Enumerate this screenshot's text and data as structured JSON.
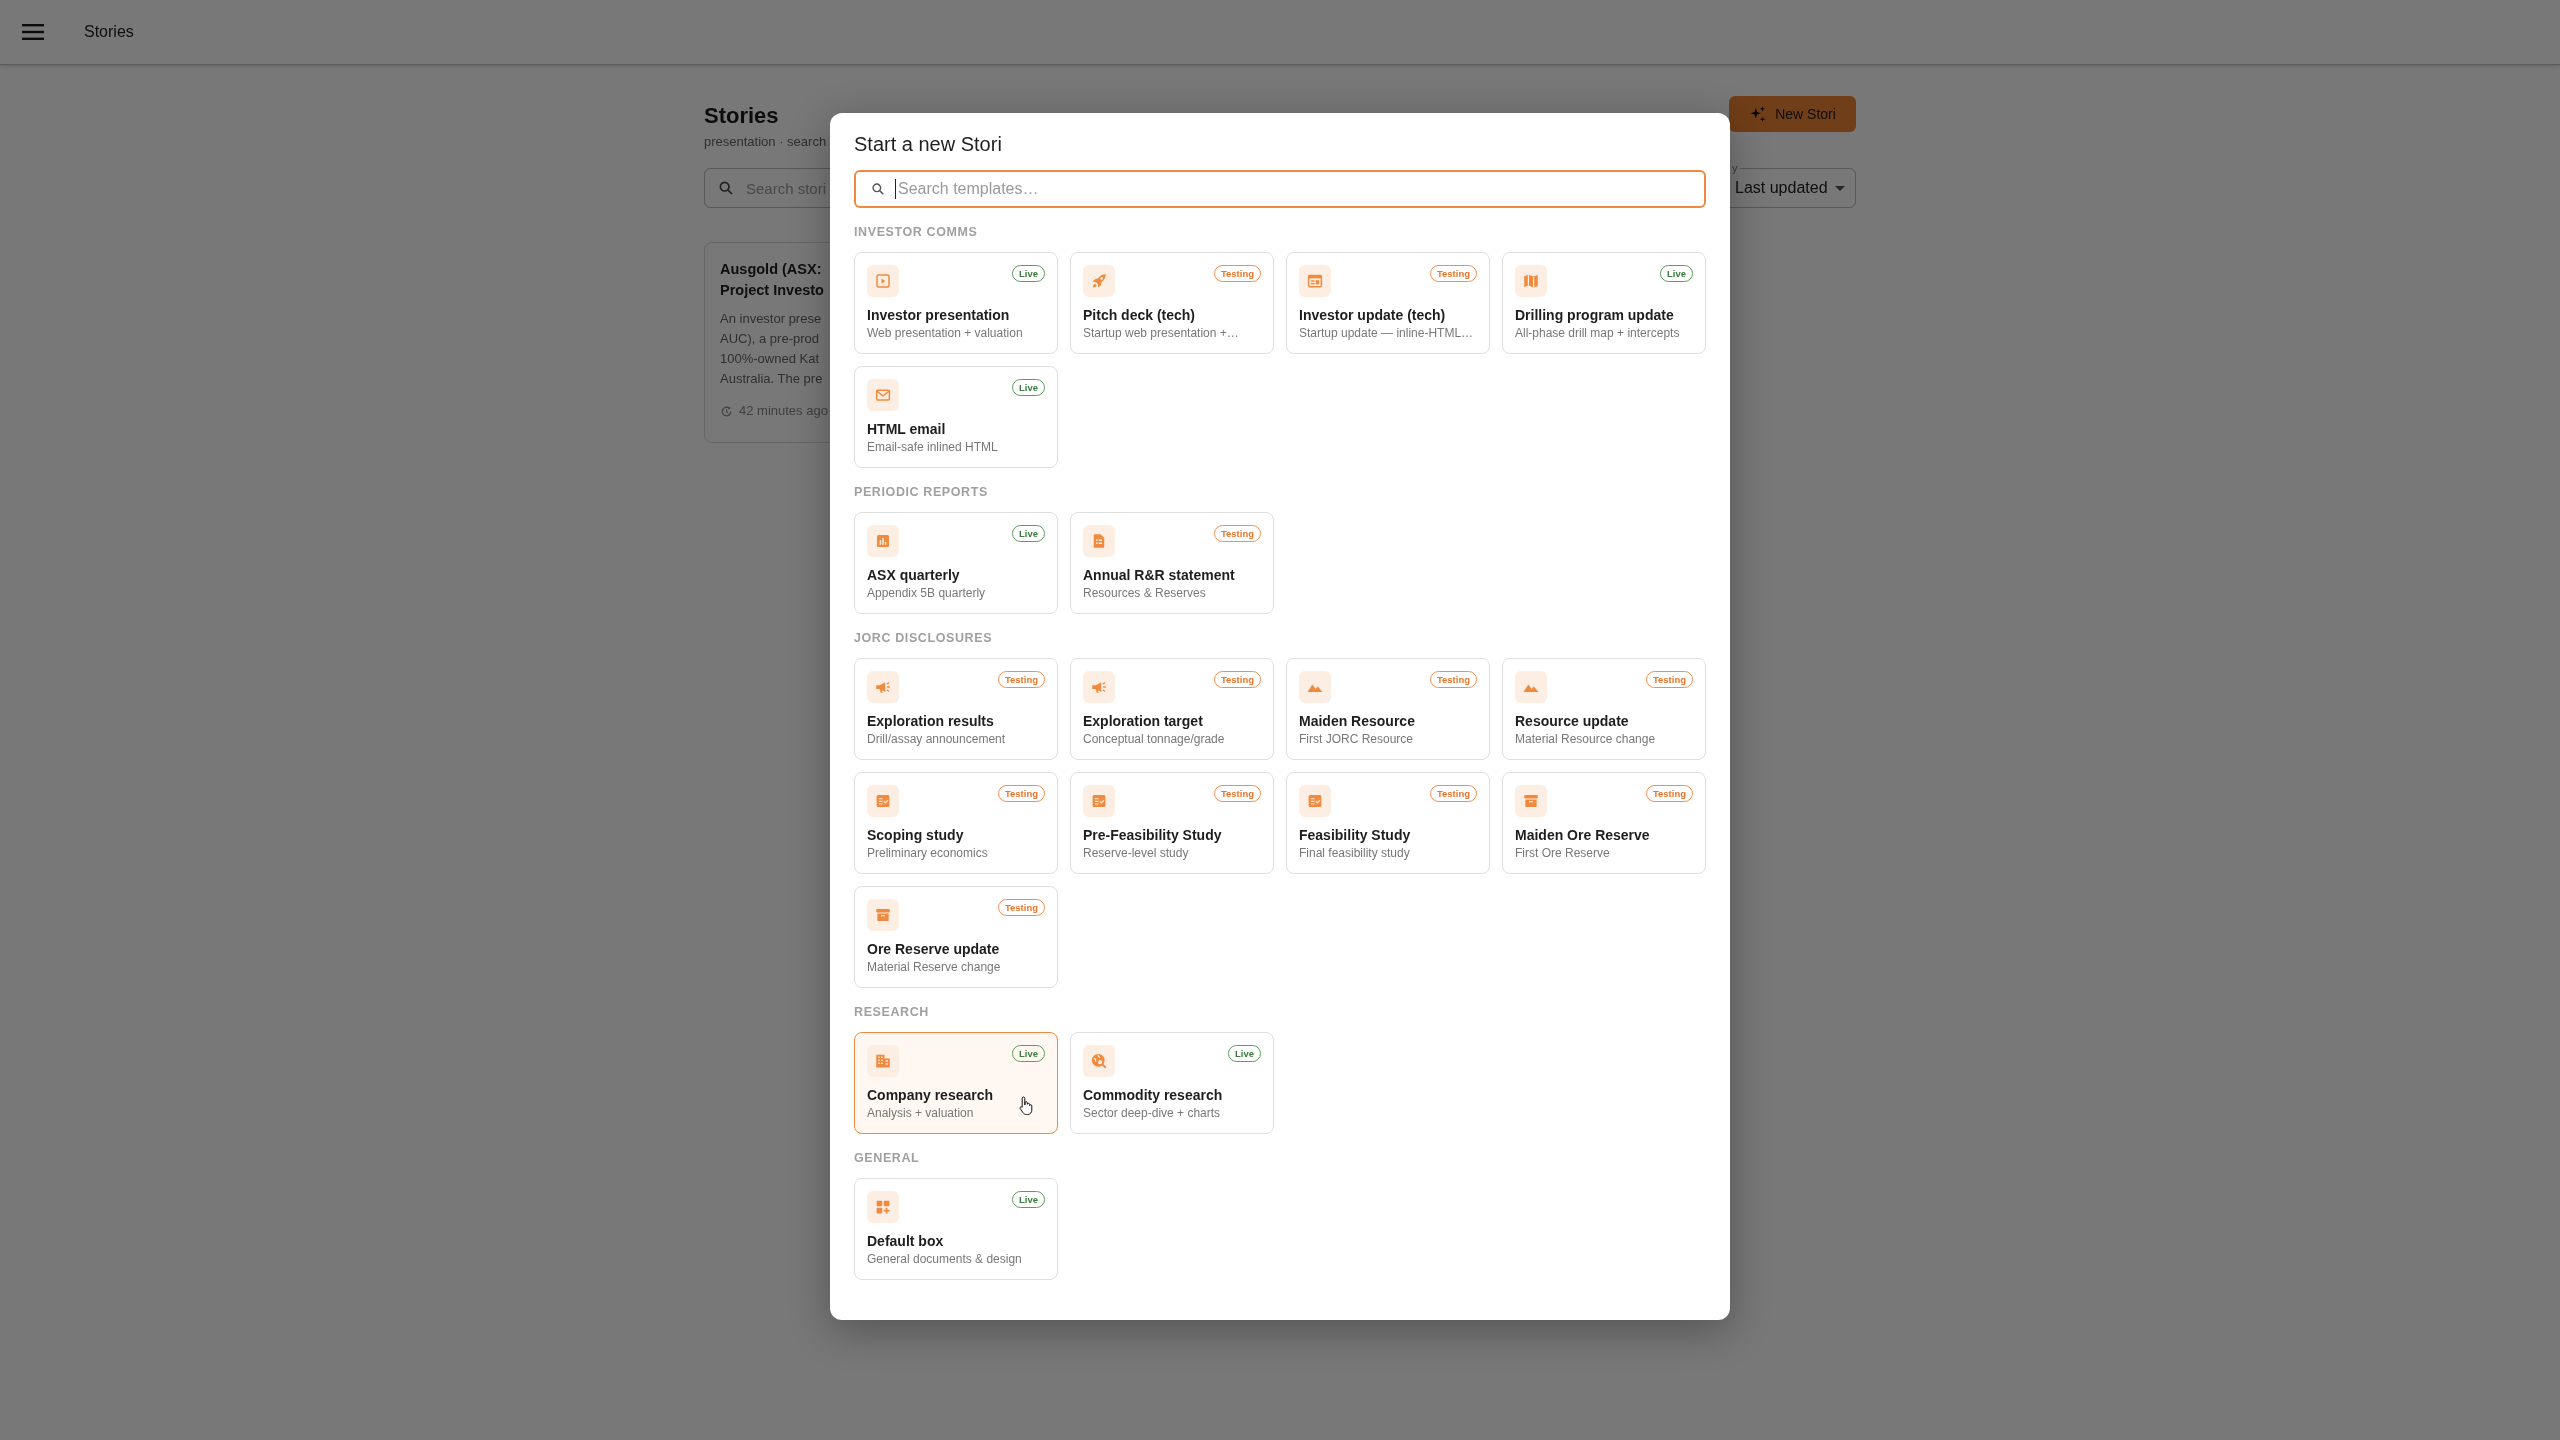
{
  "app_bar": {
    "title": "Stories"
  },
  "page": {
    "heading": "Stories",
    "subtitle": "presentation · search",
    "search": {
      "placeholder": "Search stori"
    },
    "new_button": "New Stori",
    "sort": {
      "label": "y",
      "value": "Last updated"
    },
    "stories": [
      {
        "title": "Ausgold (ASX:\nProject Investo",
        "description": "An investor prese\nAUC), a pre-prod\n100%-owned Kat\nAustralia. The pre",
        "updated": "42 minutes ago"
      }
    ]
  },
  "dialog": {
    "title": "Start a new Stori",
    "search": {
      "placeholder": "Search templates…",
      "focused": true
    },
    "sections": [
      {
        "title": "INVESTOR COMMS",
        "templates": [
          {
            "name": "Investor presentation",
            "description": "Web presentation + valuation",
            "badge": {
              "kind": "live",
              "label": "Live"
            },
            "hovered": false
          },
          {
            "name": "Pitch deck (tech)",
            "description": "Startup web presentation +…",
            "badge": {
              "kind": "testing",
              "label": "Testing"
            },
            "hovered": false
          },
          {
            "name": "Investor update (tech)",
            "description": "Startup update — inline-HTML…",
            "badge": {
              "kind": "testing",
              "label": "Testing"
            },
            "hovered": false
          },
          {
            "name": "Drilling program update",
            "description": "All-phase drill map + intercepts",
            "badge": {
              "kind": "live",
              "label": "Live"
            },
            "hovered": false
          },
          {
            "name": "HTML email",
            "description": "Email-safe inlined HTML",
            "badge": {
              "kind": "live",
              "label": "Live"
            },
            "hovered": false
          }
        ]
      },
      {
        "title": "PERIODIC REPORTS",
        "templates": [
          {
            "name": "ASX quarterly",
            "description": "Appendix 5B quarterly",
            "badge": {
              "kind": "live",
              "label": "Live"
            },
            "hovered": false
          },
          {
            "name": "Annual R&R statement",
            "description": "Resources & Reserves",
            "badge": {
              "kind": "testing",
              "label": "Testing"
            },
            "hovered": false
          }
        ]
      },
      {
        "title": "JORC DISCLOSURES",
        "templates": [
          {
            "name": "Exploration results",
            "description": "Drill/assay announcement",
            "badge": {
              "kind": "testing",
              "label": "Testing"
            },
            "hovered": false
          },
          {
            "name": "Exploration target",
            "description": "Conceptual tonnage/grade",
            "badge": {
              "kind": "testing",
              "label": "Testing"
            },
            "hovered": false
          },
          {
            "name": "Maiden Resource",
            "description": "First JORC Resource",
            "badge": {
              "kind": "testing",
              "label": "Testing"
            },
            "hovered": false
          },
          {
            "name": "Resource update",
            "description": "Material Resource change",
            "badge": {
              "kind": "testing",
              "label": "Testing"
            },
            "hovered": false
          },
          {
            "name": "Scoping study",
            "description": "Preliminary economics",
            "badge": {
              "kind": "testing",
              "label": "Testing"
            },
            "hovered": false
          },
          {
            "name": "Pre-Feasibility Study",
            "description": "Reserve-level study",
            "badge": {
              "kind": "testing",
              "label": "Testing"
            },
            "hovered": false
          },
          {
            "name": "Feasibility Study",
            "description": "Final feasibility study",
            "badge": {
              "kind": "testing",
              "label": "Testing"
            },
            "hovered": false
          },
          {
            "name": "Maiden Ore Reserve",
            "description": "First Ore Reserve",
            "badge": {
              "kind": "testing",
              "label": "Testing"
            },
            "hovered": false
          },
          {
            "name": "Ore Reserve update",
            "description": "Material Reserve change",
            "badge": {
              "kind": "testing",
              "label": "Testing"
            },
            "hovered": false
          }
        ]
      },
      {
        "title": "RESEARCH",
        "templates": [
          {
            "name": "Company research",
            "description": "Analysis + valuation",
            "badge": {
              "kind": "live",
              "label": "Live"
            },
            "hovered": true
          },
          {
            "name": "Commodity research",
            "description": "Sector deep-dive + charts",
            "badge": {
              "kind": "live",
              "label": "Live"
            },
            "hovered": false
          }
        ]
      },
      {
        "title": "GENERAL",
        "templates": [
          {
            "name": "Default box",
            "description": "General documents & design",
            "badge": {
              "kind": "live",
              "label": "Live"
            },
            "hovered": false
          }
        ]
      }
    ]
  }
}
